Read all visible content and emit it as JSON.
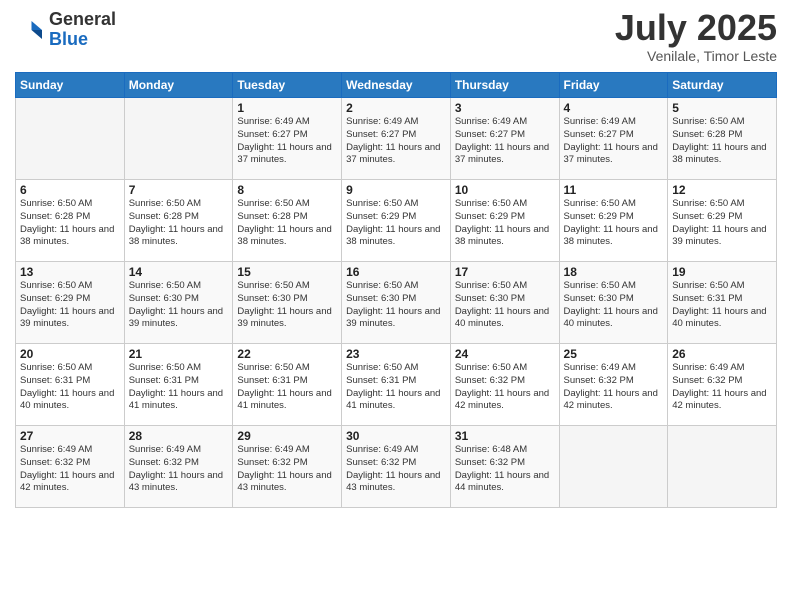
{
  "logo": {
    "general": "General",
    "blue": "Blue"
  },
  "title": "July 2025",
  "subtitle": "Venilale, Timor Leste",
  "days_of_week": [
    "Sunday",
    "Monday",
    "Tuesday",
    "Wednesday",
    "Thursday",
    "Friday",
    "Saturday"
  ],
  "weeks": [
    [
      {
        "day": "",
        "info": ""
      },
      {
        "day": "",
        "info": ""
      },
      {
        "day": "1",
        "info": "Sunrise: 6:49 AM\nSunset: 6:27 PM\nDaylight: 11 hours and 37 minutes."
      },
      {
        "day": "2",
        "info": "Sunrise: 6:49 AM\nSunset: 6:27 PM\nDaylight: 11 hours and 37 minutes."
      },
      {
        "day": "3",
        "info": "Sunrise: 6:49 AM\nSunset: 6:27 PM\nDaylight: 11 hours and 37 minutes."
      },
      {
        "day": "4",
        "info": "Sunrise: 6:49 AM\nSunset: 6:27 PM\nDaylight: 11 hours and 37 minutes."
      },
      {
        "day": "5",
        "info": "Sunrise: 6:50 AM\nSunset: 6:28 PM\nDaylight: 11 hours and 38 minutes."
      }
    ],
    [
      {
        "day": "6",
        "info": "Sunrise: 6:50 AM\nSunset: 6:28 PM\nDaylight: 11 hours and 38 minutes."
      },
      {
        "day": "7",
        "info": "Sunrise: 6:50 AM\nSunset: 6:28 PM\nDaylight: 11 hours and 38 minutes."
      },
      {
        "day": "8",
        "info": "Sunrise: 6:50 AM\nSunset: 6:28 PM\nDaylight: 11 hours and 38 minutes."
      },
      {
        "day": "9",
        "info": "Sunrise: 6:50 AM\nSunset: 6:29 PM\nDaylight: 11 hours and 38 minutes."
      },
      {
        "day": "10",
        "info": "Sunrise: 6:50 AM\nSunset: 6:29 PM\nDaylight: 11 hours and 38 minutes."
      },
      {
        "day": "11",
        "info": "Sunrise: 6:50 AM\nSunset: 6:29 PM\nDaylight: 11 hours and 38 minutes."
      },
      {
        "day": "12",
        "info": "Sunrise: 6:50 AM\nSunset: 6:29 PM\nDaylight: 11 hours and 39 minutes."
      }
    ],
    [
      {
        "day": "13",
        "info": "Sunrise: 6:50 AM\nSunset: 6:29 PM\nDaylight: 11 hours and 39 minutes."
      },
      {
        "day": "14",
        "info": "Sunrise: 6:50 AM\nSunset: 6:30 PM\nDaylight: 11 hours and 39 minutes."
      },
      {
        "day": "15",
        "info": "Sunrise: 6:50 AM\nSunset: 6:30 PM\nDaylight: 11 hours and 39 minutes."
      },
      {
        "day": "16",
        "info": "Sunrise: 6:50 AM\nSunset: 6:30 PM\nDaylight: 11 hours and 39 minutes."
      },
      {
        "day": "17",
        "info": "Sunrise: 6:50 AM\nSunset: 6:30 PM\nDaylight: 11 hours and 40 minutes."
      },
      {
        "day": "18",
        "info": "Sunrise: 6:50 AM\nSunset: 6:30 PM\nDaylight: 11 hours and 40 minutes."
      },
      {
        "day": "19",
        "info": "Sunrise: 6:50 AM\nSunset: 6:31 PM\nDaylight: 11 hours and 40 minutes."
      }
    ],
    [
      {
        "day": "20",
        "info": "Sunrise: 6:50 AM\nSunset: 6:31 PM\nDaylight: 11 hours and 40 minutes."
      },
      {
        "day": "21",
        "info": "Sunrise: 6:50 AM\nSunset: 6:31 PM\nDaylight: 11 hours and 41 minutes."
      },
      {
        "day": "22",
        "info": "Sunrise: 6:50 AM\nSunset: 6:31 PM\nDaylight: 11 hours and 41 minutes."
      },
      {
        "day": "23",
        "info": "Sunrise: 6:50 AM\nSunset: 6:31 PM\nDaylight: 11 hours and 41 minutes."
      },
      {
        "day": "24",
        "info": "Sunrise: 6:50 AM\nSunset: 6:32 PM\nDaylight: 11 hours and 42 minutes."
      },
      {
        "day": "25",
        "info": "Sunrise: 6:49 AM\nSunset: 6:32 PM\nDaylight: 11 hours and 42 minutes."
      },
      {
        "day": "26",
        "info": "Sunrise: 6:49 AM\nSunset: 6:32 PM\nDaylight: 11 hours and 42 minutes."
      }
    ],
    [
      {
        "day": "27",
        "info": "Sunrise: 6:49 AM\nSunset: 6:32 PM\nDaylight: 11 hours and 42 minutes."
      },
      {
        "day": "28",
        "info": "Sunrise: 6:49 AM\nSunset: 6:32 PM\nDaylight: 11 hours and 43 minutes."
      },
      {
        "day": "29",
        "info": "Sunrise: 6:49 AM\nSunset: 6:32 PM\nDaylight: 11 hours and 43 minutes."
      },
      {
        "day": "30",
        "info": "Sunrise: 6:49 AM\nSunset: 6:32 PM\nDaylight: 11 hours and 43 minutes."
      },
      {
        "day": "31",
        "info": "Sunrise: 6:48 AM\nSunset: 6:32 PM\nDaylight: 11 hours and 44 minutes."
      },
      {
        "day": "",
        "info": ""
      },
      {
        "day": "",
        "info": ""
      }
    ]
  ]
}
